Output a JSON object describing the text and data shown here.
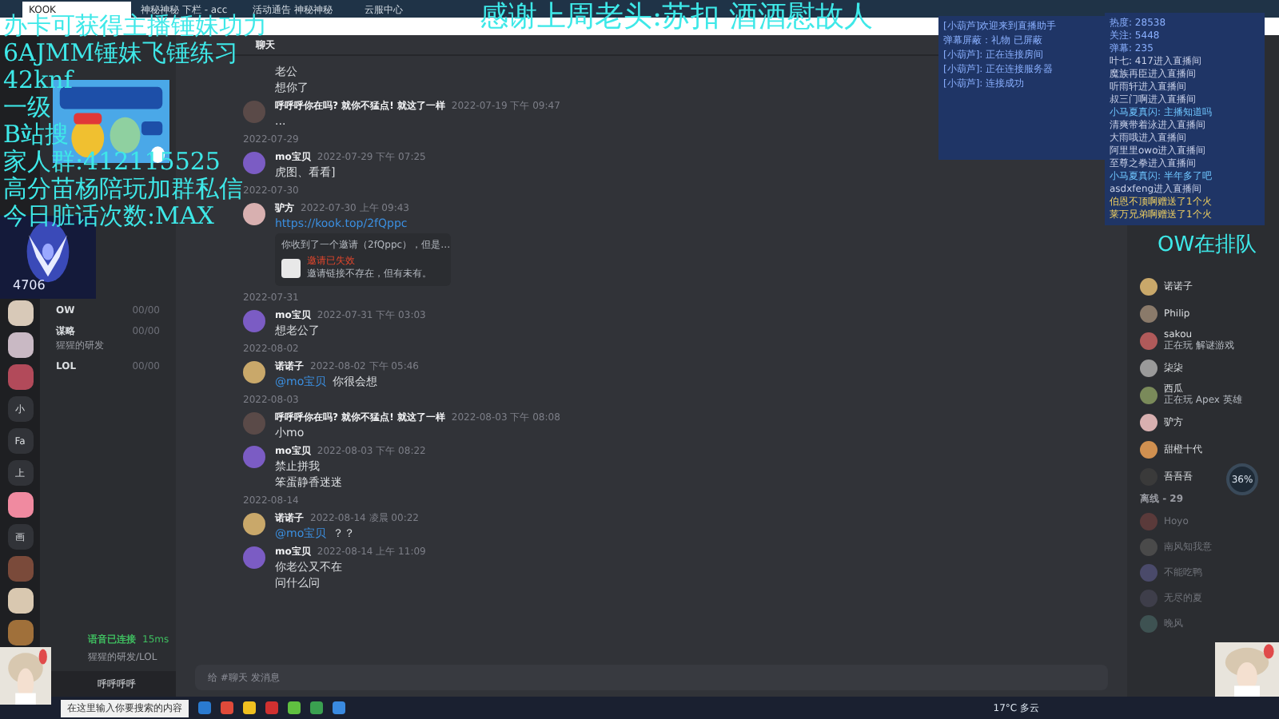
{
  "browser": {
    "tabs": [
      {
        "label": "KOOK",
        "selected": true
      },
      {
        "label": "神秘神秘 下栏 - acc",
        "selected": false
      },
      {
        "label": "活动通告 神秘神秘",
        "selected": false
      },
      {
        "label": "云服中心",
        "selected": false
      }
    ]
  },
  "servers": [
    {
      "kind": "avatar",
      "color": "#d8c9b8"
    },
    {
      "kind": "avatar",
      "color": "#c9b9c4"
    },
    {
      "kind": "avatar",
      "color": "#b24a5a"
    },
    {
      "kind": "letter",
      "label": "小"
    },
    {
      "kind": "letter",
      "label": "Fa"
    },
    {
      "kind": "letter",
      "label": "上"
    },
    {
      "kind": "avatar",
      "color": "#f08aa0"
    },
    {
      "kind": "letter",
      "label": "画"
    },
    {
      "kind": "avatar",
      "color": "#7a4a3a"
    },
    {
      "kind": "avatar",
      "color": "#d9c8b0"
    },
    {
      "kind": "avatar",
      "color": "#a0703a"
    }
  ],
  "channels": [
    {
      "name": "OW",
      "count": "00/00"
    },
    {
      "name": "谋略",
      "count": "00/00",
      "note": "猩猩的研发"
    },
    {
      "name": "LOL",
      "count": "00/00"
    }
  ],
  "voice_status": {
    "title": "语音已连接",
    "ping": "15ms",
    "detail": "猩猩的研发/LOL"
  },
  "user": {
    "name": "呼呼呼呼"
  },
  "chat": {
    "title": "聊天",
    "placeholder": "给 #聊天 发消息",
    "items": [
      {
        "kind": "cont",
        "lines": [
          "老公",
          "想你了"
        ]
      },
      {
        "kind": "msg",
        "author": "呼呼呼你在吗? 就你不猛点! 就这了一样",
        "time": "2022-07-19 下午 09:47",
        "color": "#5a4a48",
        "lines": [
          "..."
        ]
      },
      {
        "kind": "date",
        "text": "2022-07-29"
      },
      {
        "kind": "msg",
        "author": "mo宝贝",
        "time": "2022-07-29 下午 07:25",
        "color": "#7b5cc4",
        "lines": [
          "虎图、看看]"
        ]
      },
      {
        "kind": "date",
        "text": "2022-07-30"
      },
      {
        "kind": "msg",
        "author": "驴方",
        "time": "2022-07-30 上午 09:43",
        "color": "#d8b0b0",
        "link": "https://kook.top/2fQppc",
        "embed": {
          "intro": "你收到了一个邀请（2fQppc），但是…",
          "title": "邀请已失效",
          "text": "邀请链接不存在，但有未有。"
        }
      },
      {
        "kind": "date",
        "text": "2022-07-31"
      },
      {
        "kind": "msg",
        "author": "mo宝贝",
        "time": "2022-07-31 下午 03:03",
        "color": "#7b5cc4",
        "lines": [
          "想老公了"
        ]
      },
      {
        "kind": "date",
        "text": "2022-08-02"
      },
      {
        "kind": "msg",
        "author": "诺诺子",
        "time": "2022-08-02 下午 05:46",
        "color": "#c9a86a",
        "mention": "@mo宝贝",
        "lines": [
          "你很会想"
        ]
      },
      {
        "kind": "date",
        "text": "2022-08-03"
      },
      {
        "kind": "msg",
        "author": "呼呼呼你在吗? 就你不猛点! 就这了一样",
        "time": "2022-08-03 下午 08:08",
        "color": "#5a4a48",
        "lines": [
          "小mo"
        ]
      },
      {
        "kind": "msg",
        "author": "mo宝贝",
        "time": "2022-08-03 下午 08:22",
        "color": "#7b5cc4",
        "lines": [
          "禁止拼我",
          "笨蛋静香迷迷"
        ]
      },
      {
        "kind": "date",
        "text": "2022-08-14"
      },
      {
        "kind": "msg",
        "author": "诺诺子",
        "time": "2022-08-14 凌晨 00:22",
        "color": "#c9a86a",
        "mention": "@mo宝贝",
        "lines": [
          "？？"
        ]
      },
      {
        "kind": "msg",
        "author": "mo宝贝",
        "time": "2022-08-14 上午 11:09",
        "color": "#7b5cc4",
        "lines": [
          "你老公又不在",
          "问什么问"
        ]
      }
    ]
  },
  "members": {
    "online": [
      {
        "name": "诺诺子",
        "color": "#c9a86a"
      },
      {
        "name": "Philip",
        "color": "#8a7a6a"
      },
      {
        "name": "sakou",
        "activity": "正在玩 解谜游戏",
        "color": "#b05a5a"
      },
      {
        "name": "柒柒",
        "color": "#9a9a9a"
      },
      {
        "name": "西瓜",
        "activity": "正在玩 Apex 英雄",
        "color": "#7a8a5a"
      },
      {
        "name": "驴方",
        "color": "#d8b0b0"
      },
      {
        "name": "甜橙十代",
        "color": "#d09050"
      },
      {
        "name": "吾吾吾",
        "color": "#3a3a3a"
      }
    ],
    "offline_header": "离线 - 29",
    "offline": [
      {
        "name": "Hoyo",
        "color": "#5a3a3a"
      },
      {
        "name": "南风知我意",
        "color": "#4a4a4a"
      },
      {
        "name": "不能吃鸭",
        "color": "#4a4a6a"
      },
      {
        "name": "无尽的夏",
        "color": "#3e3e4a"
      },
      {
        "name": "晚风",
        "color": "#3e5252"
      }
    ]
  },
  "net_widget": {
    "percent": "36%"
  },
  "overlay": {
    "lines": [
      "办卡可获得主播锤妹功力",
      "6AJMM锤妹飞锤练习",
      "42knf",
      "一级",
      "B站搜",
      "家人群:412115525",
      "高分苗杨陪玩加群私信",
      "今日脏话次数:MAX"
    ],
    "thanks": "感谢上周老头:苏扣 酒酒慰故人",
    "queue": "OW在排队",
    "rank": "4706"
  },
  "danmu": {
    "log": [
      "[小葫芦]欢迎来到直播助手",
      "弹幕屏蔽：礼物 已屏蔽",
      "[小葫芦]: 正在连接房间",
      "[小葫芦]: 正在连接服务器",
      "[小葫芦]: 连接成功"
    ],
    "stats": [
      "热度: 28538",
      "关注: 5448",
      "弹幕: 235"
    ],
    "entries": [
      {
        "text": "叶七: 417进入直播间",
        "kind": "enter"
      },
      {
        "text": "魔族再臣进入直播间",
        "kind": "enter"
      },
      {
        "text": "听雨轩进入直播间",
        "kind": "enter"
      },
      {
        "text": "叔三门啊进入直播间",
        "kind": "enter"
      },
      {
        "text": "小马夏真闪: 主播知道吗",
        "kind": "chat"
      },
      {
        "text": "清爽带着泳进入直播间",
        "kind": "enter"
      },
      {
        "text": "大雨哦进入直播间",
        "kind": "enter"
      },
      {
        "text": "阿里里owo进入直播间",
        "kind": "enter"
      },
      {
        "text": "至尊之拳进入直播间",
        "kind": "enter"
      },
      {
        "text": "小马夏真闪: 半年多了吧",
        "kind": "chat"
      },
      {
        "text": "asdxfeng进入直播间",
        "kind": "enter"
      },
      {
        "text": "伯恩不顶啊赠送了1个火",
        "kind": "gift"
      },
      {
        "text": "莱万兄弟啊赠送了1个火",
        "kind": "gift"
      }
    ]
  },
  "taskbar": {
    "weather": "17°C 多云",
    "search": "在这里输入你要搜索的内容"
  }
}
